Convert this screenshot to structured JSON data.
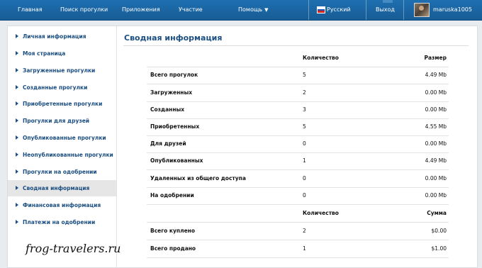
{
  "topnav": {
    "home": "Главная",
    "search": "Поиск прогулки",
    "apps": "Приложения",
    "participation": "Участие",
    "help": "Помощь",
    "language": "Русский",
    "logout": "Выход",
    "username": "maruska1005"
  },
  "sidebar": {
    "items": [
      {
        "label": "Личная информация"
      },
      {
        "label": "Моя страница"
      },
      {
        "label": "Загруженные прогулки"
      },
      {
        "label": "Созданные прогулки"
      },
      {
        "label": "Приобретенные прогулки"
      },
      {
        "label": "Прогулки для друзей"
      },
      {
        "label": "Опубликованные прогулки"
      },
      {
        "label": "Неопубликованные прогулки"
      },
      {
        "label": "Прогулки на одобрении"
      },
      {
        "label": "Сводная информация"
      },
      {
        "label": "Финансовая информация"
      },
      {
        "label": "Платежи на одобрении"
      }
    ],
    "active_index": 9
  },
  "main": {
    "title": "Сводная информация",
    "table1": {
      "headers": {
        "label": "",
        "qty": "Количество",
        "size": "Размер"
      },
      "rows": [
        {
          "label": "Всего прогулок",
          "qty": "5",
          "size": "4.49 Mb"
        },
        {
          "label": "Загруженных",
          "qty": "2",
          "size": "0.00 Mb"
        },
        {
          "label": "Созданных",
          "qty": "3",
          "size": "0.00 Mb"
        },
        {
          "label": "Приобретенных",
          "qty": "5",
          "size": "4.55 Mb"
        },
        {
          "label": "Для друзей",
          "qty": "0",
          "size": "0.00 Mb"
        },
        {
          "label": "Опубликованных",
          "qty": "1",
          "size": "4.49 Mb"
        },
        {
          "label": "Удаленных из общего доступа",
          "qty": "0",
          "size": "0.00 Mb"
        },
        {
          "label": "На одобрении",
          "qty": "0",
          "size": "0.00 Mb"
        }
      ]
    },
    "table2": {
      "headers": {
        "label": "",
        "qty": "Количество",
        "size": "Сумма"
      },
      "rows": [
        {
          "label": "Всего куплено",
          "qty": "2",
          "size": "$0.00"
        },
        {
          "label": "Всего продано",
          "qty": "1",
          "size": "$1.00"
        }
      ]
    }
  },
  "watermark": "frog-travelers.ru",
  "icons": {
    "flag": "russia-flag-icon",
    "avatar": "user-avatar",
    "help_chevron": "chevron-down-icon",
    "sidebar_arrow": "triangle-right-icon"
  },
  "colors": {
    "topbar": "#1f6fb0",
    "link": "#1c4f83",
    "active_bg": "#e6e6e6"
  }
}
